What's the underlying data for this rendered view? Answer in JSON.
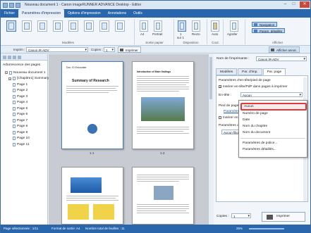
{
  "window": {
    "title": "Nouveau document 1 - Canon imageRUNNER ADVANCE Desktop - Editor",
    "min": "–",
    "max": "□",
    "close": "✕"
  },
  "menu": [
    "Fichier",
    "Paramètres d'impression",
    "Options d'impression",
    "Annotations",
    "Outils"
  ],
  "ribbon": {
    "groups": [
      "Modèles",
      "Sortie papier",
      "Disposition",
      "Coul.",
      "Afficher"
    ],
    "paper_size": "A4",
    "orientation": "Portrait",
    "pages_per_sheet": "1",
    "pages_per_sheet_sub": "sur 1",
    "duplex": "Recto",
    "color": "Auto",
    "staple": "Agrafer",
    "navigation": "Navigation",
    "detailed_params": "Param. détaillés"
  },
  "toolbar": {
    "printer_label": "Imprim :",
    "printer_value": "Canon iR-ADV",
    "copies_label": "Copies :",
    "copies_value": "1",
    "print_button": "Imprimer",
    "show_annot": "Afficher annot."
  },
  "left_pane": {
    "title": "Arborescence des pages",
    "tree": [
      {
        "label": "Nouveau document 1",
        "level": 1,
        "expander": "−"
      },
      {
        "label": "[Chapitre1] Summary o",
        "level": 2,
        "expander": "−"
      },
      {
        "label": "Page 1",
        "level": 3
      },
      {
        "label": "Page 2",
        "level": 3
      },
      {
        "label": "Page 3",
        "level": 3
      },
      {
        "label": "Page 4",
        "level": 3
      },
      {
        "label": "Page 5",
        "level": 3
      },
      {
        "label": "Page 6",
        "level": 3
      },
      {
        "label": "Page 7",
        "level": 3
      },
      {
        "label": "Page 8",
        "level": 3
      },
      {
        "label": "Page 9",
        "level": 3
      },
      {
        "label": "Page 10",
        "level": 3
      },
      {
        "label": "Page 11",
        "level": 3
      }
    ]
  },
  "pages": [
    {
      "label": "1-1",
      "title": "Summary of Research",
      "header": "Doc. ID Encounter"
    },
    {
      "label": "1-2",
      "title": "Introduction of Main findings"
    },
    {
      "label": "",
      "title": ""
    },
    {
      "label": "",
      "title": ""
    }
  ],
  "right_pane": {
    "printer_label": "Nom de l'imprimante :",
    "printer_value": "Canon iR-ADV",
    "tabs": [
      "Modèles",
      "Par. d'imp.",
      "Par. page"
    ],
    "section_title": "Paramètres d'en-tête/pied de page",
    "chk_header_text": "Insérer en-tête/PdP dans pages à imprimer",
    "header_label": "En-tête :",
    "header_value": "Aucun",
    "footer_label": "Pied de page",
    "param_link": "Paramètres",
    "insert_label": "Insérer en",
    "params_label": "Paramètres d",
    "filigrane_value": "Aucun filigr",
    "copies_label": "Copies :",
    "copies_value": "1",
    "print_button": "Imprimer"
  },
  "dropdown": {
    "options": [
      "Aucun",
      "Numéro de page",
      "Date",
      "Nom du chapitre",
      "Nom du document",
      "Paramètres de police...",
      "Paramètres détaillés..."
    ],
    "selected": "Aucun"
  },
  "status": {
    "selected": "Page sélectionnée : 1/11",
    "format": "Format de sortie: A4",
    "total": "Nombre total de feuilles : 11",
    "zoom": "25%"
  },
  "colors": {
    "accent": "#2a66ac",
    "highlight": "#e03a3a"
  }
}
